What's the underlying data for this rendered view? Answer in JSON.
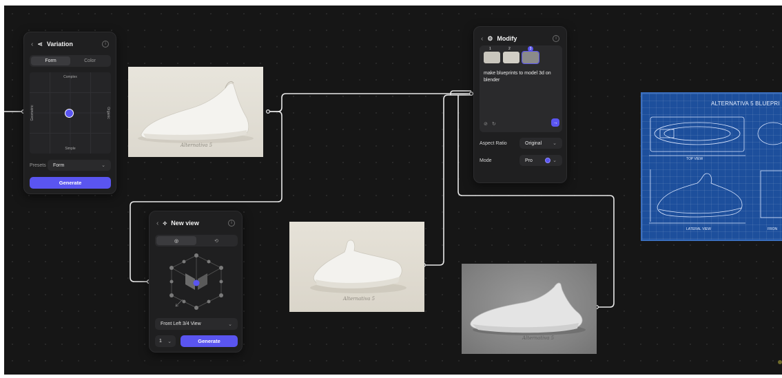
{
  "variation": {
    "title": "Variation",
    "tabs": [
      {
        "label": "Form",
        "active": true
      },
      {
        "label": "Color",
        "active": false
      }
    ],
    "axes": {
      "top": "Complex",
      "bottom": "Simple",
      "left": "Geometric",
      "right": "Organic"
    },
    "presets_label": "Presets",
    "preset_value": "Form",
    "generate_label": "Generate"
  },
  "image1": {
    "caption": "Alternativa 5"
  },
  "image2": {
    "caption": "Alternativa 5"
  },
  "image3": {
    "caption": "Alternativa 5"
  },
  "blueprint": {
    "title": "ALTERNATIVA 5 BLUEPRI",
    "views": [
      "TOP VIEW",
      "LATERAL VIEW",
      "FRON"
    ]
  },
  "new_view": {
    "title": "New view",
    "view_select": "Front Left 3/4 View",
    "count": "1",
    "generate_label": "Generate"
  },
  "modify": {
    "title": "Modify",
    "thumbs": [
      "1",
      "2",
      "3"
    ],
    "selected_thumb": 3,
    "prompt": "make blueprints to model 3d on blender",
    "aspect_ratio_label": "Aspect Ratio",
    "aspect_ratio_value": "Original",
    "mode_label": "Mode",
    "mode_value": "Pro"
  },
  "colors": {
    "accent": "#5a55f0",
    "canvas": "#161616",
    "panel": "#1f1f20",
    "blueprint": "#1d4f9c"
  }
}
